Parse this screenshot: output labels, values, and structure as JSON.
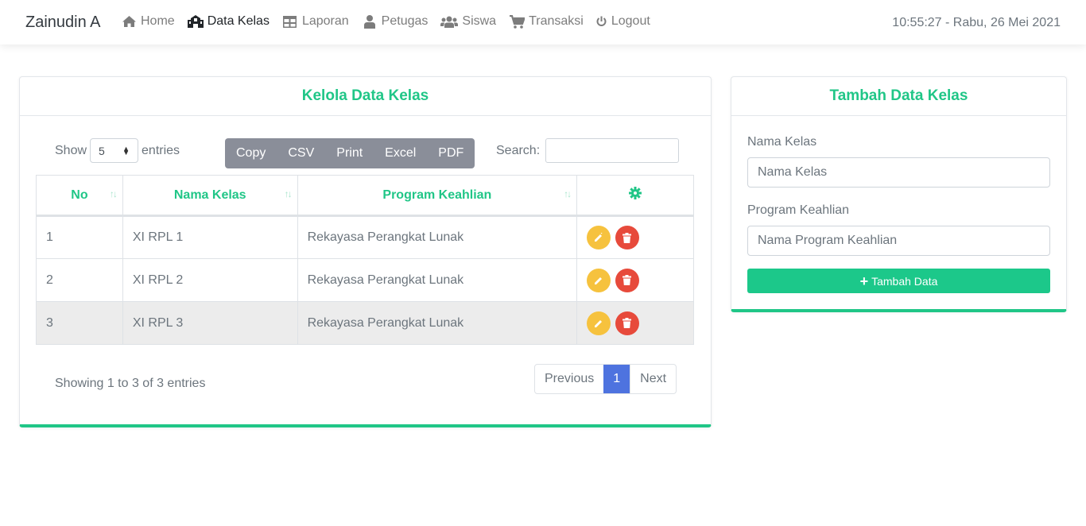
{
  "navbar": {
    "brand": "Zainudin A",
    "items": [
      {
        "label": "Home",
        "icon": "home-icon"
      },
      {
        "label": "Data Kelas",
        "icon": "school-icon"
      },
      {
        "label": "Laporan",
        "icon": "table-icon"
      },
      {
        "label": "Petugas",
        "icon": "user-icon"
      },
      {
        "label": "Siswa",
        "icon": "users-icon"
      },
      {
        "label": "Transaksi",
        "icon": "cart-icon"
      },
      {
        "label": "Logout",
        "icon": "power-icon"
      }
    ],
    "active": "Data Kelas",
    "datetime": "10:55:27 - Rabu, 26 Mei 2021"
  },
  "kelola": {
    "title": "Kelola Data Kelas",
    "show_label": "Show",
    "entries_label": "entries",
    "page_length": "5",
    "export_buttons": [
      "Copy",
      "CSV",
      "Print",
      "Excel",
      "PDF"
    ],
    "search_label": "Search:",
    "search_value": "",
    "columns": [
      "No",
      "Nama Kelas",
      "Program Keahlian"
    ],
    "action_column_icon": "gear-icon",
    "rows": [
      {
        "no": "1",
        "nama_kelas": "XI RPL 1",
        "program": "Rekayasa Perangkat Lunak"
      },
      {
        "no": "2",
        "nama_kelas": "XI RPL 2",
        "program": "Rekayasa Perangkat Lunak"
      },
      {
        "no": "3",
        "nama_kelas": "XI RPL 3",
        "program": "Rekayasa Perangkat Lunak"
      }
    ],
    "info": "Showing 1 to 3 of 3 entries",
    "pagination": {
      "previous": "Previous",
      "current": "1",
      "next": "Next"
    }
  },
  "tambah": {
    "title": "Tambah Data Kelas",
    "nama_kelas_label": "Nama Kelas",
    "nama_kelas_placeholder": "Nama Kelas",
    "program_label": "Program Keahlian",
    "program_placeholder": "Nama Program Keahlian",
    "submit_label": "Tambah Data"
  },
  "colors": {
    "accent": "#20c687",
    "edit": "#f6c23e",
    "delete": "#e74a3b",
    "page_active": "#4e73df",
    "export_group": "#8a8e99"
  }
}
